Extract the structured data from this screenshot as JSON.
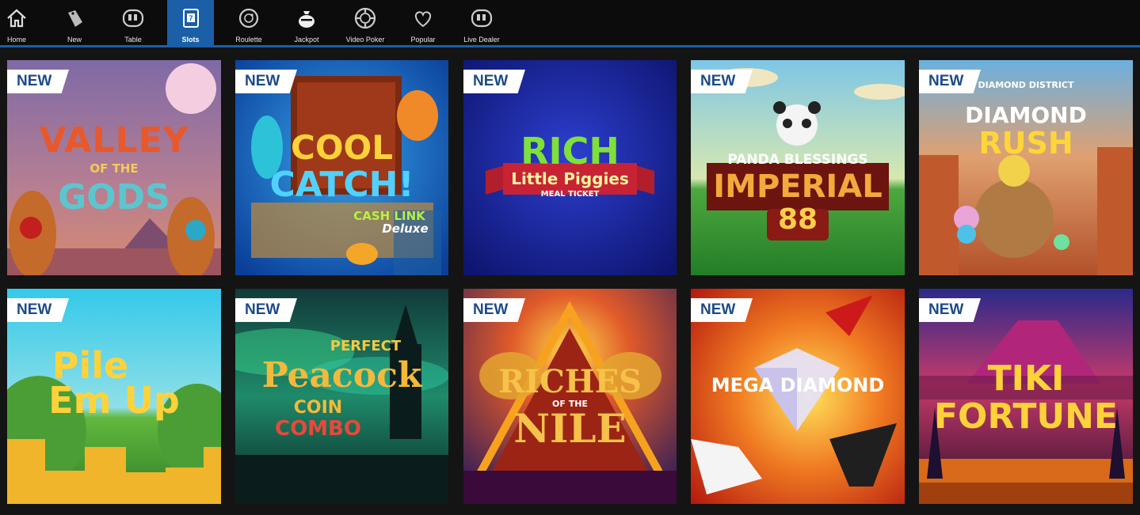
{
  "nav": {
    "items": [
      {
        "label": "Home",
        "icon": "home-icon"
      },
      {
        "label": "New",
        "icon": "tag-icon"
      },
      {
        "label": "Table",
        "icon": "chip-icon"
      },
      {
        "label": "Slots",
        "icon": "slot-machine-icon",
        "active": true
      },
      {
        "label": "Roulette",
        "icon": "roulette-icon"
      },
      {
        "label": "Jackpot",
        "icon": "money-bag-icon"
      },
      {
        "label": "Video Poker",
        "icon": "poker-chip-icon"
      },
      {
        "label": "Popular",
        "icon": "heart-icon"
      },
      {
        "label": "Live Dealer",
        "icon": "chip-icon"
      }
    ],
    "accent": "#1a5fa8"
  },
  "games": [
    {
      "badge": "NEW",
      "title_lines": [
        "VALLEY",
        "OF THE",
        "GODS"
      ]
    },
    {
      "badge": "NEW",
      "title_lines": [
        "COOL",
        "CATCH!",
        "CASH LINK",
        "Deluxe"
      ]
    },
    {
      "badge": "NEW",
      "title_lines": [
        "RICH",
        "Little Piggies",
        "MEAL TICKET"
      ]
    },
    {
      "badge": "NEW",
      "title_lines": [
        "PANDA BLESSINGS",
        "IMPERIAL",
        "88"
      ]
    },
    {
      "badge": "NEW",
      "title_lines": [
        "DIAMOND DISTRICT",
        "DIAMOND",
        "RUSH"
      ]
    },
    {
      "badge": "NEW",
      "title_lines": [
        "Pile",
        "Em Up"
      ]
    },
    {
      "badge": "NEW",
      "title_lines": [
        "PERFECT",
        "Peacock",
        "COIN",
        "COMBO"
      ]
    },
    {
      "badge": "NEW",
      "title_lines": [
        "RICHES",
        "OF THE",
        "NILE"
      ]
    },
    {
      "badge": "NEW",
      "title_lines": [
        "MEGA DIAMOND"
      ]
    },
    {
      "badge": "NEW",
      "title_lines": [
        "TIKI",
        "FORTUNE"
      ]
    }
  ]
}
